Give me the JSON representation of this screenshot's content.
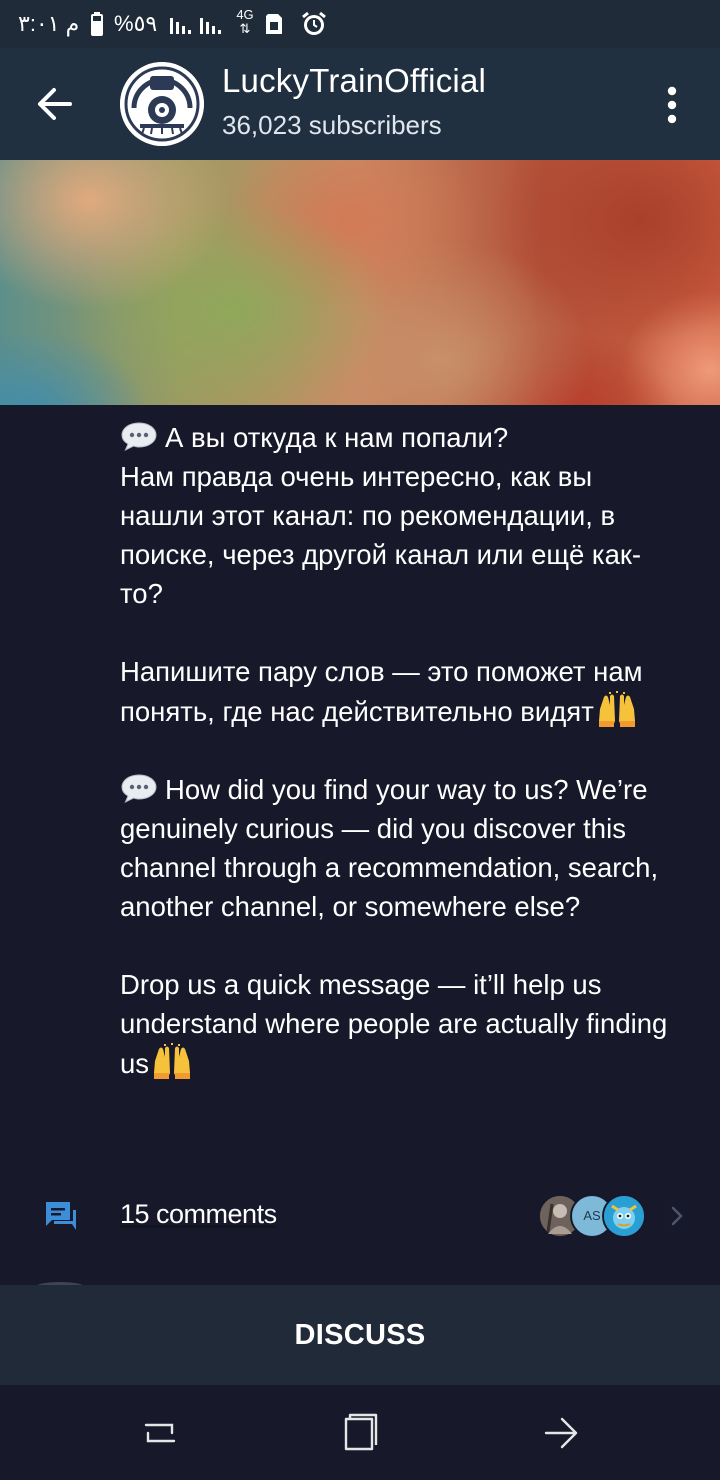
{
  "status_bar": {
    "time": "م ٣:٠١",
    "battery": "%٥٩",
    "network": "4G"
  },
  "header": {
    "title": "LuckyTrainOfficial",
    "subscribers": "36,023 subscribers"
  },
  "post": {
    "paragraphs": [
      "А вы откуда к нам попали?\nНам правда очень интересно, как вы нашли этот канал: по рекомендации, в поиске, через другой канал или ещё как-то?",
      "Напишите пару слов — это поможет нам понять, где нас действительно видят",
      "How did you find your way to us? We’re genuinely curious — did you discover this channel through a recommendation, search, another channel, or somewhere else?",
      "Drop us a quick message — it’ll help us understand where people are actually finding us"
    ]
  },
  "comments": {
    "label": "15 comments",
    "avatar_initials": "AS"
  },
  "discuss": {
    "label": "DISCUSS"
  },
  "colors": {
    "background": "#17192a",
    "header": "#213041",
    "accent": "#3b8fd8"
  },
  "icons": [
    "back-arrow-icon",
    "more-vertical-icon",
    "comments-icon",
    "chevron-right-icon",
    "speech-bubble-emoji",
    "raising-hands-emoji",
    "recent-apps-icon",
    "home-icon",
    "back-nav-icon"
  ]
}
